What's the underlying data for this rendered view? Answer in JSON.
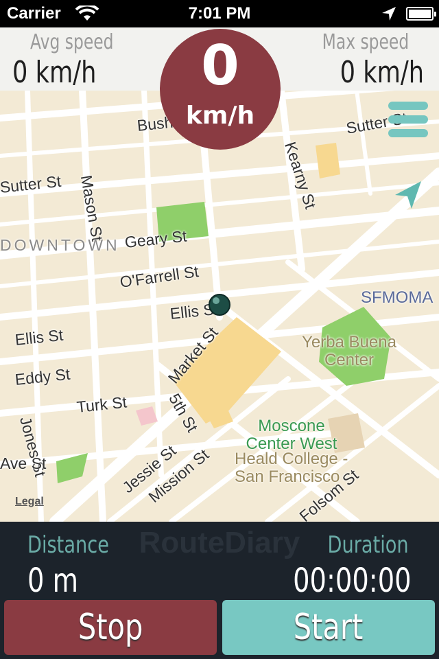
{
  "status_bar": {
    "carrier": "Carrier",
    "time": "7:01 PM"
  },
  "speed_panel": {
    "avg_label": "Avg speed",
    "avg_value": "0 km/h",
    "max_label": "Max speed",
    "max_value": "0 km/h",
    "current_speed": "0",
    "current_unit": "km/h",
    "accent_color": "#8a3b42"
  },
  "map": {
    "streets": [
      "Mason St",
      "Kearny St",
      "Bush St",
      "Sutter St",
      "Geary St",
      "O'Farrell St",
      "Ellis St",
      "Market St",
      "Eddy St",
      "Turk St",
      "5th St",
      "Jessie St",
      "Mission St",
      "Jones St",
      "Folsom St",
      "Ave St"
    ],
    "district": "DOWNTOWN",
    "pois": {
      "sfmoma": "SFMOMA",
      "yerba_buena": "Yerba Buena Center",
      "moscone": "Moscone Center West",
      "heald": "Heald College - San Francisco"
    },
    "legal": "Legal"
  },
  "bottom": {
    "watermark": "RouteDiary",
    "distance_label": "Distance",
    "distance_value": "0 m",
    "duration_label": "Duration",
    "duration_value": "00:00:00",
    "stop_label": "Stop",
    "start_label": "Start",
    "stop_color": "#8a3b42",
    "start_color": "#78c8c2"
  }
}
